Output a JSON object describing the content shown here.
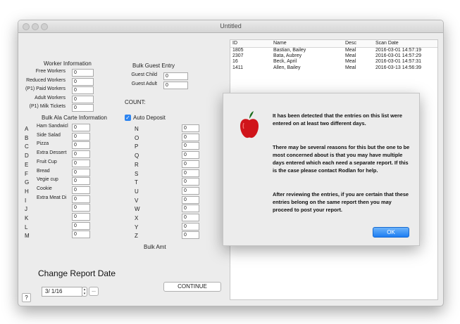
{
  "window": {
    "title": "Untitled"
  },
  "worker": {
    "heading": "Worker Information",
    "rows": [
      {
        "label": "Free Workers",
        "value": "0"
      },
      {
        "label": "Reduced Workers",
        "value": "0"
      },
      {
        "label": "(P1) Paid Workers",
        "value": "0"
      },
      {
        "label": "Adult Workers",
        "value": "0"
      },
      {
        "label": "(P1) Milk Tickets",
        "value": "0"
      }
    ]
  },
  "bulk_guest": {
    "heading": "Bulk Guest Entry",
    "rows": [
      {
        "label": "Guest Child",
        "value": "0"
      },
      {
        "label": "Guest Adult",
        "value": "0"
      }
    ]
  },
  "count": {
    "label": "COUNT:"
  },
  "auto_deposit": {
    "label": "Auto Deposit",
    "checked": true
  },
  "ala_carte": {
    "heading": "Bulk Ala Carte Information",
    "letters": [
      "A",
      "B",
      "C",
      "D",
      "E",
      "F",
      "G",
      "H",
      "I",
      "J",
      "K",
      "L",
      "M"
    ],
    "items": [
      {
        "label": "Ham Sandwicl",
        "value": "0"
      },
      {
        "label": "Side Salad",
        "value": "0"
      },
      {
        "label": "Pizza",
        "value": "0"
      },
      {
        "label": "Extra Dessert",
        "value": "0"
      },
      {
        "label": "Fruit Cup",
        "value": "0"
      },
      {
        "label": "Bread",
        "value": "0"
      },
      {
        "label": "Vegie cup",
        "value": "0"
      },
      {
        "label": "Cookie",
        "value": "0"
      },
      {
        "label": "Extra Meat Di",
        "value": "0"
      },
      {
        "label": "",
        "value": "0"
      },
      {
        "label": "",
        "value": "0"
      },
      {
        "label": "",
        "value": "0"
      },
      {
        "label": "",
        "value": "0"
      }
    ]
  },
  "bulk_letters": {
    "items": [
      {
        "letter": "N",
        "value": "0"
      },
      {
        "letter": "O",
        "value": "0"
      },
      {
        "letter": "P",
        "value": "0"
      },
      {
        "letter": "Q",
        "value": "0"
      },
      {
        "letter": "R",
        "value": "0"
      },
      {
        "letter": "S",
        "value": "0"
      },
      {
        "letter": "T",
        "value": "0"
      },
      {
        "letter": "U",
        "value": "0"
      },
      {
        "letter": "V",
        "value": "0"
      },
      {
        "letter": "W",
        "value": "0"
      },
      {
        "letter": "X",
        "value": "0"
      },
      {
        "letter": "Y",
        "value": "0"
      },
      {
        "letter": "Z",
        "value": "0"
      }
    ],
    "footer": "Bulk Amt"
  },
  "report": {
    "heading": "Change Report Date",
    "date_value": "3/ 1/16",
    "ellipsis_label": "...",
    "continue_label": "CONTINUE",
    "help_label": "?"
  },
  "list": {
    "columns": [
      "ID",
      "Name",
      "Desc",
      "Scan Date"
    ],
    "rows": [
      [
        "1805",
        "Bastian, Bailey",
        "Meal",
        "2016-03-01 14:57:19"
      ],
      [
        "2307",
        "Bata, Aubrey",
        "Meal",
        "2016-03-01 14:57:29"
      ],
      [
        "16",
        "Beck, April",
        "Meal",
        "2016-03-01 14:57:31"
      ],
      [
        "1411",
        "Allen, Bailey",
        "Meal",
        "2016-03-13 14:56:39"
      ]
    ]
  },
  "dialog": {
    "paragraphs": [
      "It has been detected that the entries on this list were entered on at least two different days.",
      "There may be several reasons for this but the one to be most concerned about is that you may have multiple days entered which each need a separate report. If this is the case please contact Rodlan for help.",
      "After reviewing the entries, if you are certain that these entries belong on the same report then you may proceed to post your report."
    ],
    "ok_label": "OK",
    "icon": "apple-icon"
  },
  "colors": {
    "accent": "#1d7df2",
    "apple": "#d0141a"
  }
}
